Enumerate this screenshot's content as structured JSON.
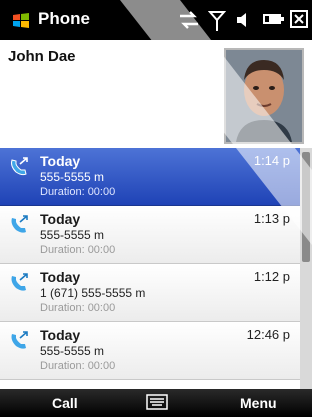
{
  "app": {
    "title": "Phone"
  },
  "status": {
    "icons": [
      "data-connection-icon",
      "signal-strength-icon",
      "volume-icon",
      "battery-icon",
      "close-icon"
    ]
  },
  "contact": {
    "name": "John Dae"
  },
  "calls": [
    {
      "day": "Today",
      "time": "1:14 p",
      "number": "555-5555 m",
      "duration": "Duration: 00:00",
      "selected": true
    },
    {
      "day": "Today",
      "time": "1:13 p",
      "number": "555-5555 m",
      "duration": "Duration: 00:00",
      "selected": false
    },
    {
      "day": "Today",
      "time": "1:12 p",
      "number": "1 (671) 555-5555 m",
      "duration": "Duration: 00:00",
      "selected": false
    },
    {
      "day": "Today",
      "time": "12:46 p",
      "number": "555-5555 m",
      "duration": "Duration: 00:00",
      "selected": false
    }
  ],
  "softkeys": {
    "left": "Call",
    "right": "Menu"
  },
  "colors": {
    "selection": "#2a4ec4",
    "titlebar": "#000000"
  }
}
